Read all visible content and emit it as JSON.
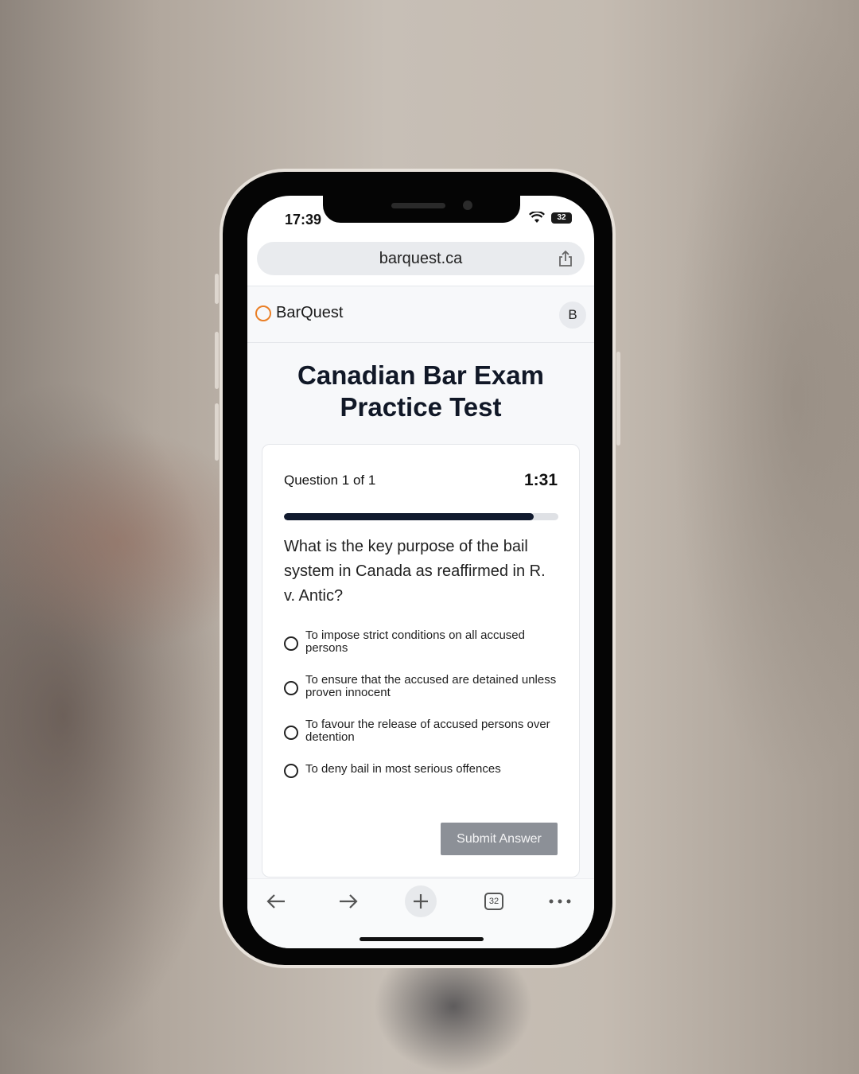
{
  "status_bar": {
    "time": "17:39",
    "battery": "32"
  },
  "browser": {
    "url": "barquest.ca",
    "icons": [
      "share-icon",
      "back-arrow-icon",
      "forward-arrow-icon",
      "plus-icon",
      "tabs-icon",
      "more-icon"
    ],
    "tab_count": "32"
  },
  "site": {
    "brand": "BarQuest",
    "brand_color": "#ea7f26",
    "avatar_initial": "B",
    "title": "Canadian Bar Exam Practice Test"
  },
  "quiz": {
    "question_counter": "Question 1 of 1",
    "timer": "1:31",
    "progress_fraction": 0.91,
    "question": "What is the key purpose of the bail system in Canada as reaffirmed in R. v. Antic?",
    "options": [
      "To impose strict conditions on all accused persons",
      "To ensure that the accused are detained unless proven innocent",
      "To favour the release of accused persons over detention",
      "To deny bail in most serious offences"
    ],
    "submit_label": "Submit Answer"
  }
}
